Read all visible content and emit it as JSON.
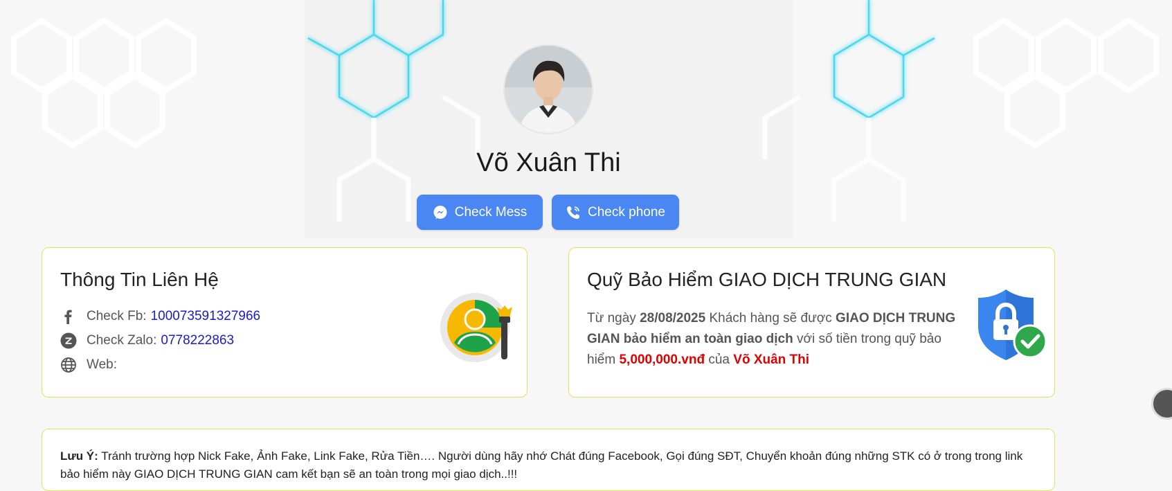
{
  "profile": {
    "name": "Võ Xuân Thi"
  },
  "buttons": {
    "mess_label": "Check Mess",
    "phone_label": "Check phone"
  },
  "contact": {
    "title": "Thông Tin Liên Hệ",
    "fb_label": "Check Fb:",
    "fb_value": "100073591327966",
    "zalo_label": "Check Zalo:",
    "zalo_value": "0778222863",
    "web_label": "Web:",
    "web_value": ""
  },
  "insurance": {
    "title": "Quỹ Bảo Hiểm GIAO DỊCH TRUNG GIAN",
    "text_1": "Từ ngày ",
    "date": "28/08/2025",
    "text_2": " Khách hàng sẽ được ",
    "highlight": "GIAO DỊCH TRUNG GIAN bảo hiểm an toàn giao dịch",
    "text_3": " với số tiền trong quỹ bảo hiểm ",
    "amount": "5,000,000.vnđ",
    "text_4": " của ",
    "owner": "Võ Xuân Thi"
  },
  "note": {
    "label": "Lưu Ý:",
    "text": " Tránh trường hợp Nick Fake, Ảnh Fake, Link Fake, Rửa Tiền…. Người dùng hãy nhớ Chát đúng Facebook, Gọi đúng SĐT, Chuyển khoản đúng những STK có ở trong trong link bảo hiểm này GIAO DỊCH TRUNG GIAN cam kết bạn sẽ an toàn trong mọi giao dịch..!!!"
  },
  "colors": {
    "button": "#4b87f2",
    "card_border": "#e4e25a",
    "link_blue": "#1a1acc",
    "highlight_red": "#e00000",
    "hex_glow": "#3fd6ec"
  },
  "icons": [
    "messenger-icon",
    "phone-icon",
    "facebook-icon",
    "zalo-icon",
    "globe-icon",
    "contact-user-icon",
    "shield-lock-icon"
  ]
}
